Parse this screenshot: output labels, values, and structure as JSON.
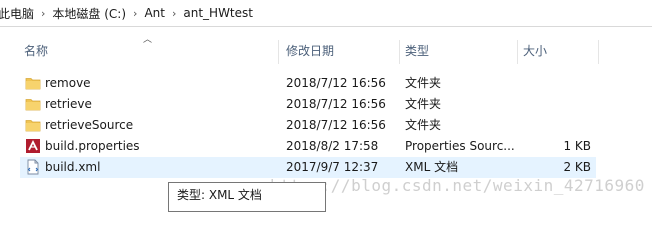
{
  "breadcrumb": [
    "此电脑",
    "本地磁盘 (C:)",
    "Ant",
    "ant_HWtest"
  ],
  "breadcrumb_separator": "›",
  "columns": {
    "name": "名称",
    "modified": "修改日期",
    "type": "类型",
    "size": "大小"
  },
  "files": [
    {
      "icon": "folder-icon",
      "name": "remove",
      "modified": "2018/7/12 16:56",
      "type": "文件夹",
      "size": ""
    },
    {
      "icon": "folder-icon",
      "name": "retrieve",
      "modified": "2018/7/12 16:56",
      "type": "文件夹",
      "size": ""
    },
    {
      "icon": "folder-icon",
      "name": "retrieveSource",
      "modified": "2018/7/12 16:56",
      "type": "文件夹",
      "size": ""
    },
    {
      "icon": "properties-file-icon",
      "name": "build.properties",
      "modified": "2018/8/2 17:58",
      "type": "Properties Sourc...",
      "size": "1 KB"
    },
    {
      "icon": "xml-file-icon",
      "name": "build.xml",
      "modified": "2017/9/7 12:37",
      "type": "XML 文档",
      "size": "2 KB"
    }
  ],
  "tooltip": "类型: XML 文档",
  "watermark": "https://blog.csdn.net/weixin_42716960",
  "colors": {
    "selected_row": "#e5f3ff",
    "header_text": "#4c607a",
    "folder": "#f0c453"
  }
}
